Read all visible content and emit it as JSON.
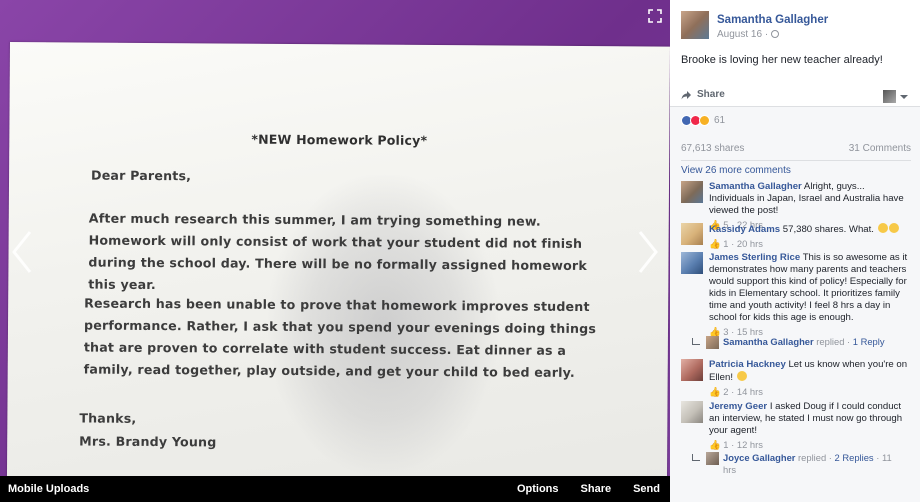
{
  "viewer": {
    "letter": {
      "title": "*NEW Homework Policy*",
      "greeting": "Dear Parents,",
      "paragraph1": "After much research this summer, I am trying something new. Homework will only consist of work that your student did not finish during the school day. There will be no formally assigned homework this year.",
      "paragraph2": "Research has been unable to prove that homework improves student performance. Rather, I ask that you spend your evenings doing things that are proven to correlate with student success. Eat dinner as a family, read together, play outside, and get your child to bed early.",
      "closing": "Thanks,",
      "signature": "Mrs. Brandy Young"
    },
    "bottom_bar": {
      "album": "Mobile Uploads",
      "options": "Options",
      "share": "Share",
      "send": "Send"
    }
  },
  "post": {
    "author": "Samantha Gallagher",
    "date": "August 16 ·",
    "text": "Brooke is loving her new teacher already!",
    "share_label": "Share",
    "reaction_count": "61",
    "shares": "67,613 shares",
    "comments": "31 Comments",
    "view_more": "View 26 more comments"
  },
  "comments": [
    {
      "name": "Samantha Gallagher",
      "text": "Alright, guys... Individuals in Japan, Israel and Australia have viewed the post!",
      "likes": "5",
      "time": "22 hrs",
      "avatar_color": "#7d6a58"
    },
    {
      "name": "Kassidy Adams",
      "text": "57,380 shares. What.",
      "likes": "1",
      "time": "20 hrs",
      "avatar_color": "#d8b27a"
    },
    {
      "name": "James Sterling Rice",
      "text": "This is so awesome as it demonstrates how many parents and teachers would support this kind of policy! Especially for kids in Elementary school. It prioritizes family time and youth activity! I feel 8 hrs a day in school for kids this age is enough.",
      "likes": "3",
      "time": "15 hrs",
      "avatar_color": "#5a7fb0"
    },
    {
      "name": "Patricia Hackney",
      "text": "Let us know when you're on Ellen!",
      "likes": "2",
      "time": "14 hrs",
      "avatar_color": "#b06b60"
    },
    {
      "name": "Jeremy Geer",
      "text": "I asked Doug if I could conduct an interview, he stated I must now go through your agent!",
      "likes": "1",
      "time": "12 hrs",
      "avatar_color": "#c4c0b8"
    }
  ],
  "replies": [
    {
      "name": "Samantha Gallagher",
      "action": "replied ·",
      "link": "1 Reply",
      "time": ""
    },
    {
      "name": "Joyce Gallagher",
      "action": "replied ·",
      "link": "2 Replies",
      "time": "11 hrs"
    }
  ]
}
